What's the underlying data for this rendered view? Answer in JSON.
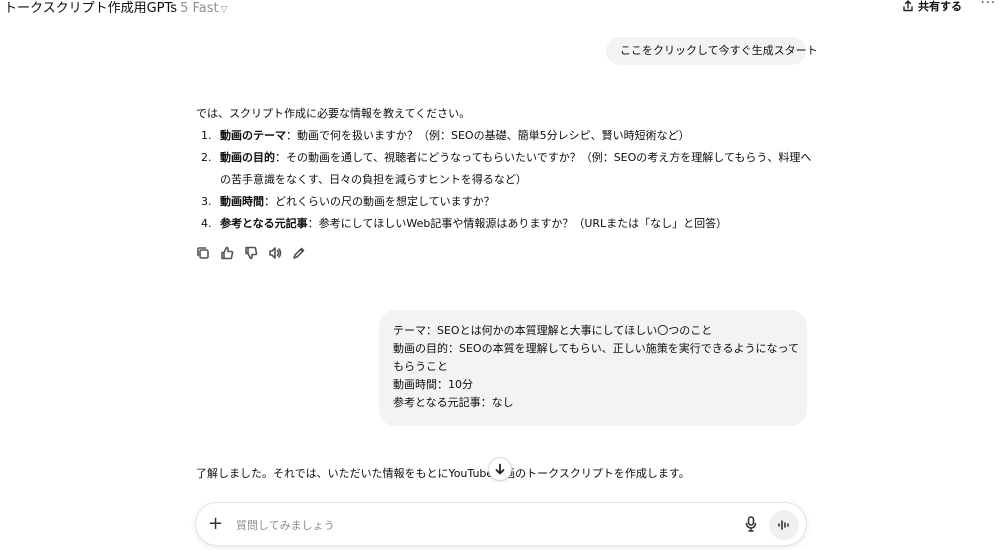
{
  "header": {
    "title": "トークスクリプト作成用GPTs",
    "model": "5 Fast",
    "share_label": "共有する",
    "more_label": "···"
  },
  "messages": {
    "user1": "ここをクリックして今すぐ生成スタート",
    "assistant1": {
      "intro": "では、スクリプト作成に必要な情報を教えてください。",
      "items": [
        {
          "num": "1.",
          "bold": "動画のテーマ",
          "text": "：動画で何を扱いますか？（例：SEOの基礎、簡単5分レシピ、賢い時短術など）"
        },
        {
          "num": "2.",
          "bold": "動画の目的",
          "text": "：その動画を通して、視聴者にどうなってもらいたいですか？（例：SEOの考え方を理解してもらう、料理への苦手意識をなくす、日々の負担を減らすヒントを得るなど）"
        },
        {
          "num": "3.",
          "bold": "動画時間",
          "text": "：どれくらいの尺の動画を想定していますか？"
        },
        {
          "num": "4.",
          "bold": "参考となる元記事",
          "text": "：参考にしてほしいWeb記事や情報源はありますか？（URLまたは「なし」と回答）"
        }
      ]
    },
    "user2": [
      "テーマ：SEOとは何かの本質理解と大事にしてほしい〇つのこと",
      "動画の目的：SEOの本質を理解してもらい、正しい施策を実行できるようになって",
      "もらうこと",
      "動画時間：10分",
      "参考となる元記事：なし"
    ],
    "assistant2": "了解しました。それでは、いただいた情報をもとにYouTube動画のトークスクリプトを作成します。"
  },
  "composer": {
    "placeholder": "質問してみましょう"
  }
}
